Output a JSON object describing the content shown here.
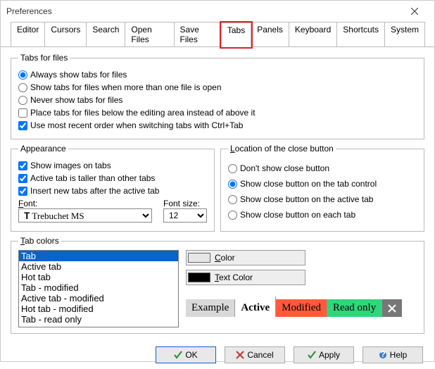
{
  "window": {
    "title": "Preferences"
  },
  "tabs": {
    "items": [
      "Editor",
      "Cursors",
      "Search",
      "Open Files",
      "Save Files",
      "Tabs",
      "Panels",
      "Keyboard",
      "Shortcuts",
      "System"
    ],
    "activeIndex": 5
  },
  "tabsForFiles": {
    "legend": "Tabs for files",
    "radio1": "Always show tabs for files",
    "radio2": "Show tabs for files when more than one file is open",
    "radio3": "Never show tabs for files",
    "chkBelow": "Place tabs for files below the editing area instead of above it",
    "chkMRU": "Use most recent order when switching tabs with Ctrl+Tab"
  },
  "appearance": {
    "legend": "Appearance",
    "chkImages": "Show images on tabs",
    "chkTaller": "Active tab is taller than other tabs",
    "chkInsert": "Insert new tabs after the active tab",
    "fontLabel": "Font:",
    "fontValue": "Trebuchet MS",
    "fontSizeLabel": "Font size:",
    "fontSizeValue": "12"
  },
  "closeButton": {
    "legend": "Location of the close button",
    "r1": "Don't show close button",
    "r2": "Show close button on the tab control",
    "r3": "Show close button on the active tab",
    "r4": "Show close button on each tab"
  },
  "tabColors": {
    "legend": "Tab colors",
    "listItems": [
      "Tab",
      "Active tab",
      "Hot tab",
      "Tab - modified",
      "Active tab - modified",
      "Hot tab - modified",
      "Tab - read only"
    ],
    "colorBtn": "Color",
    "textColorBtn": "Text Color",
    "colorSwatch": "#e6e6e6",
    "textColorSwatch": "#000000",
    "examples": {
      "example": "Example",
      "active": "Active",
      "modified": "Modified",
      "readonly": "Read only",
      "exampleBg": "#d9d9d9",
      "activeBg": "#ffffff",
      "modifiedBg": "#ff5a3c",
      "readonlyBg": "#2fd67a"
    }
  },
  "buttons": {
    "ok": "OK",
    "cancel": "Cancel",
    "apply": "Apply",
    "help": "Help"
  }
}
